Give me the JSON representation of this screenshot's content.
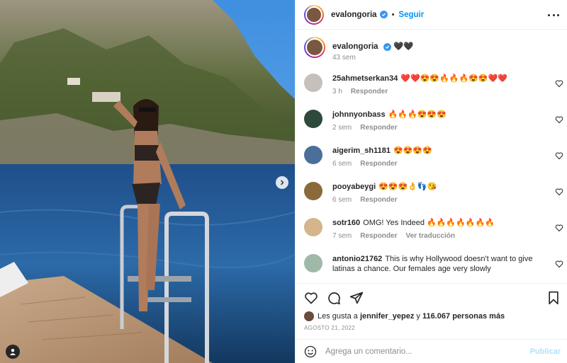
{
  "header": {
    "username": "evalongoria",
    "separator": "•",
    "follow_label": "Seguir",
    "more_icon": "more-horizontal-icon"
  },
  "caption": {
    "username": "evalongoria",
    "text": "🖤🖤",
    "time": "43 sem"
  },
  "comments": [
    {
      "user": "25ahmetserkan34",
      "text": "❤️❤️😍😍🔥🔥🔥😍😍❤️❤️",
      "time": "3 h",
      "reply": "Responder",
      "translate": ""
    },
    {
      "user": "johnnyonbass",
      "text": "🔥🔥🔥😍😍😍",
      "time": "2 sem",
      "reply": "Responder",
      "translate": ""
    },
    {
      "user": "aigerim_sh1181",
      "text": "😍😍😍😍",
      "time": "6 sem",
      "reply": "Responder",
      "translate": ""
    },
    {
      "user": "pooyabeygi",
      "text": "😍😍😍👌👣😘",
      "time": "6 sem",
      "reply": "Responder",
      "translate": ""
    },
    {
      "user": "sotr160",
      "text": "OMG! Yes Indeed 🔥🔥🔥🔥🔥🔥🔥",
      "time": "7 sem",
      "reply": "Responder",
      "translate": "Ver traducción"
    },
    {
      "user": "antonio21762",
      "text": "This is why Hollywood doesn't want to give latinas a chance. Our females age very slowly",
      "time": "",
      "reply": "",
      "translate": ""
    }
  ],
  "likes": {
    "prefix": "Les gusta a",
    "user": "jennifer_yepez",
    "conjunction": "y",
    "count": "116.067 personas más"
  },
  "date": "AGOSTO 21, 2022",
  "add_comment": {
    "placeholder": "Agrega un comentario...",
    "publish_label": "Publicar"
  },
  "colors": {
    "accent": "#0095f6",
    "verified": "#3897f0",
    "muted": "#8e8e8e",
    "publish_disabled": "#b2dffc"
  },
  "icons": [
    "heart-icon",
    "comment-icon",
    "share-icon",
    "bookmark-icon",
    "emoji-icon",
    "next-arrow-icon",
    "user-tag-icon",
    "verified-icon"
  ]
}
